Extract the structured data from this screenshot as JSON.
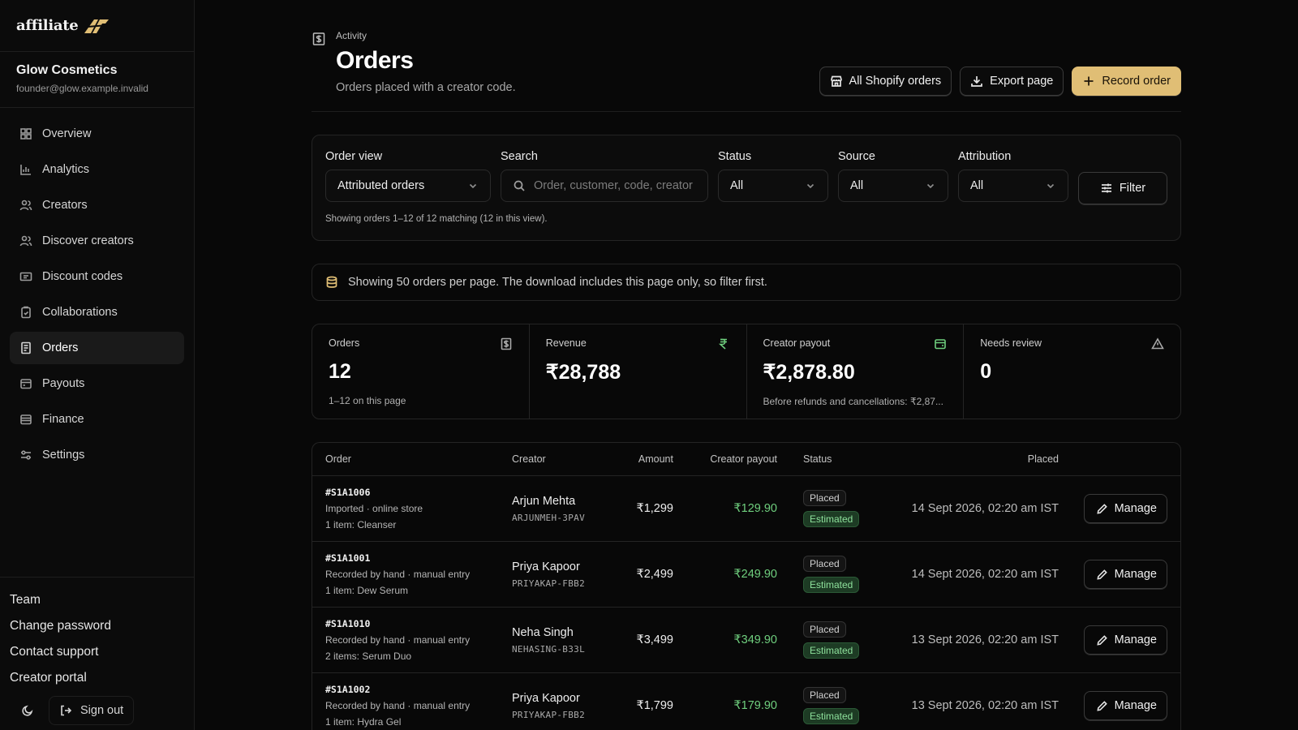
{
  "brand": {
    "name": "affiliate"
  },
  "account": {
    "name": "Glow Cosmetics",
    "email": "founder@glow.example.invalid"
  },
  "nav": [
    {
      "label": "Overview",
      "icon": "grid-icon"
    },
    {
      "label": "Analytics",
      "icon": "bar-chart-icon"
    },
    {
      "label": "Creators",
      "icon": "users-icon"
    },
    {
      "label": "Discover creators",
      "icon": "user-search-icon"
    },
    {
      "label": "Discount codes",
      "icon": "ticket-icon"
    },
    {
      "label": "Collaborations",
      "icon": "clipboard-icon"
    },
    {
      "label": "Orders",
      "icon": "receipt-icon",
      "active": true
    },
    {
      "label": "Payouts",
      "icon": "wallet-icon"
    },
    {
      "label": "Finance",
      "icon": "bank-icon"
    },
    {
      "label": "Settings",
      "icon": "sliders-icon"
    }
  ],
  "bottom_links": {
    "team": "Team",
    "change_password": "Change password",
    "contact_support": "Contact support",
    "creator_portal": "Creator portal"
  },
  "signout": "Sign out",
  "header": {
    "breadcrumb": "Activity",
    "title": "Orders",
    "subtitle": "Orders placed with a creator code.",
    "actions": {
      "shopify": "All Shopify orders",
      "export": "Export page",
      "record": "Record order"
    }
  },
  "filters": {
    "order_view": {
      "label": "Order view",
      "value": "Attributed orders"
    },
    "search": {
      "label": "Search",
      "placeholder": "Order, customer, code, creator"
    },
    "status": {
      "label": "Status",
      "value": "All"
    },
    "source": {
      "label": "Source",
      "value": "All"
    },
    "attribution": {
      "label": "Attribution",
      "value": "All"
    },
    "filter_button": "Filter",
    "note": "Showing orders 1–12 of 12 matching (12 in this view)."
  },
  "notice": "Showing 50 orders per page. The download includes this page only, so filter first.",
  "stats": [
    {
      "label": "Orders",
      "value": "12",
      "foot": "1–12 on this page",
      "icon": "receipt-icon"
    },
    {
      "label": "Revenue",
      "value": "₹28,788",
      "foot": "",
      "icon": "rupee-icon"
    },
    {
      "label": "Creator payout",
      "value": "₹2,878.80",
      "foot": "Before refunds and cancellations: ₹2,87...",
      "icon": "wallet-icon"
    },
    {
      "label": "Needs review",
      "value": "0",
      "foot": "",
      "icon": "alert-triangle-icon"
    }
  ],
  "table": {
    "headers": {
      "order": "Order",
      "creator": "Creator",
      "amount": "Amount",
      "payout": "Creator payout",
      "status": "Status",
      "placed": "Placed"
    },
    "manage_label": "Manage",
    "rows": [
      {
        "id": "#S1A1006",
        "source": "Imported · online store",
        "items": "1 item: Cleanser",
        "creator": "Arjun Mehta",
        "code": "ARJUNMEH-3PAV",
        "amount": "₹1,299",
        "payout": "₹129.90",
        "status": "Placed",
        "payout_status": "Estimated",
        "placed": "14 Sept 2026, 02:20 am IST"
      },
      {
        "id": "#S1A1001",
        "source": "Recorded by hand · manual entry",
        "items": "1 item: Dew Serum",
        "creator": "Priya Kapoor",
        "code": "PRIYAKAP-FBB2",
        "amount": "₹2,499",
        "payout": "₹249.90",
        "status": "Placed",
        "payout_status": "Estimated",
        "placed": "14 Sept 2026, 02:20 am IST"
      },
      {
        "id": "#S1A1010",
        "source": "Recorded by hand · manual entry",
        "items": "2 items: Serum Duo",
        "creator": "Neha Singh",
        "code": "NEHASING-B33L",
        "amount": "₹3,499",
        "payout": "₹349.90",
        "status": "Placed",
        "payout_status": "Estimated",
        "placed": "13 Sept 2026, 02:20 am IST"
      },
      {
        "id": "#S1A1002",
        "source": "Recorded by hand · manual entry",
        "items": "1 item: Hydra Gel",
        "creator": "Priya Kapoor",
        "code": "PRIYAKAP-FBB2",
        "amount": "₹1,799",
        "payout": "₹179.90",
        "status": "Placed",
        "payout_status": "Estimated",
        "placed": "13 Sept 2026, 02:20 am IST"
      }
    ]
  },
  "colors": {
    "accent": "#e0be75",
    "positive": "#6fcf7e",
    "background": "#080808"
  }
}
